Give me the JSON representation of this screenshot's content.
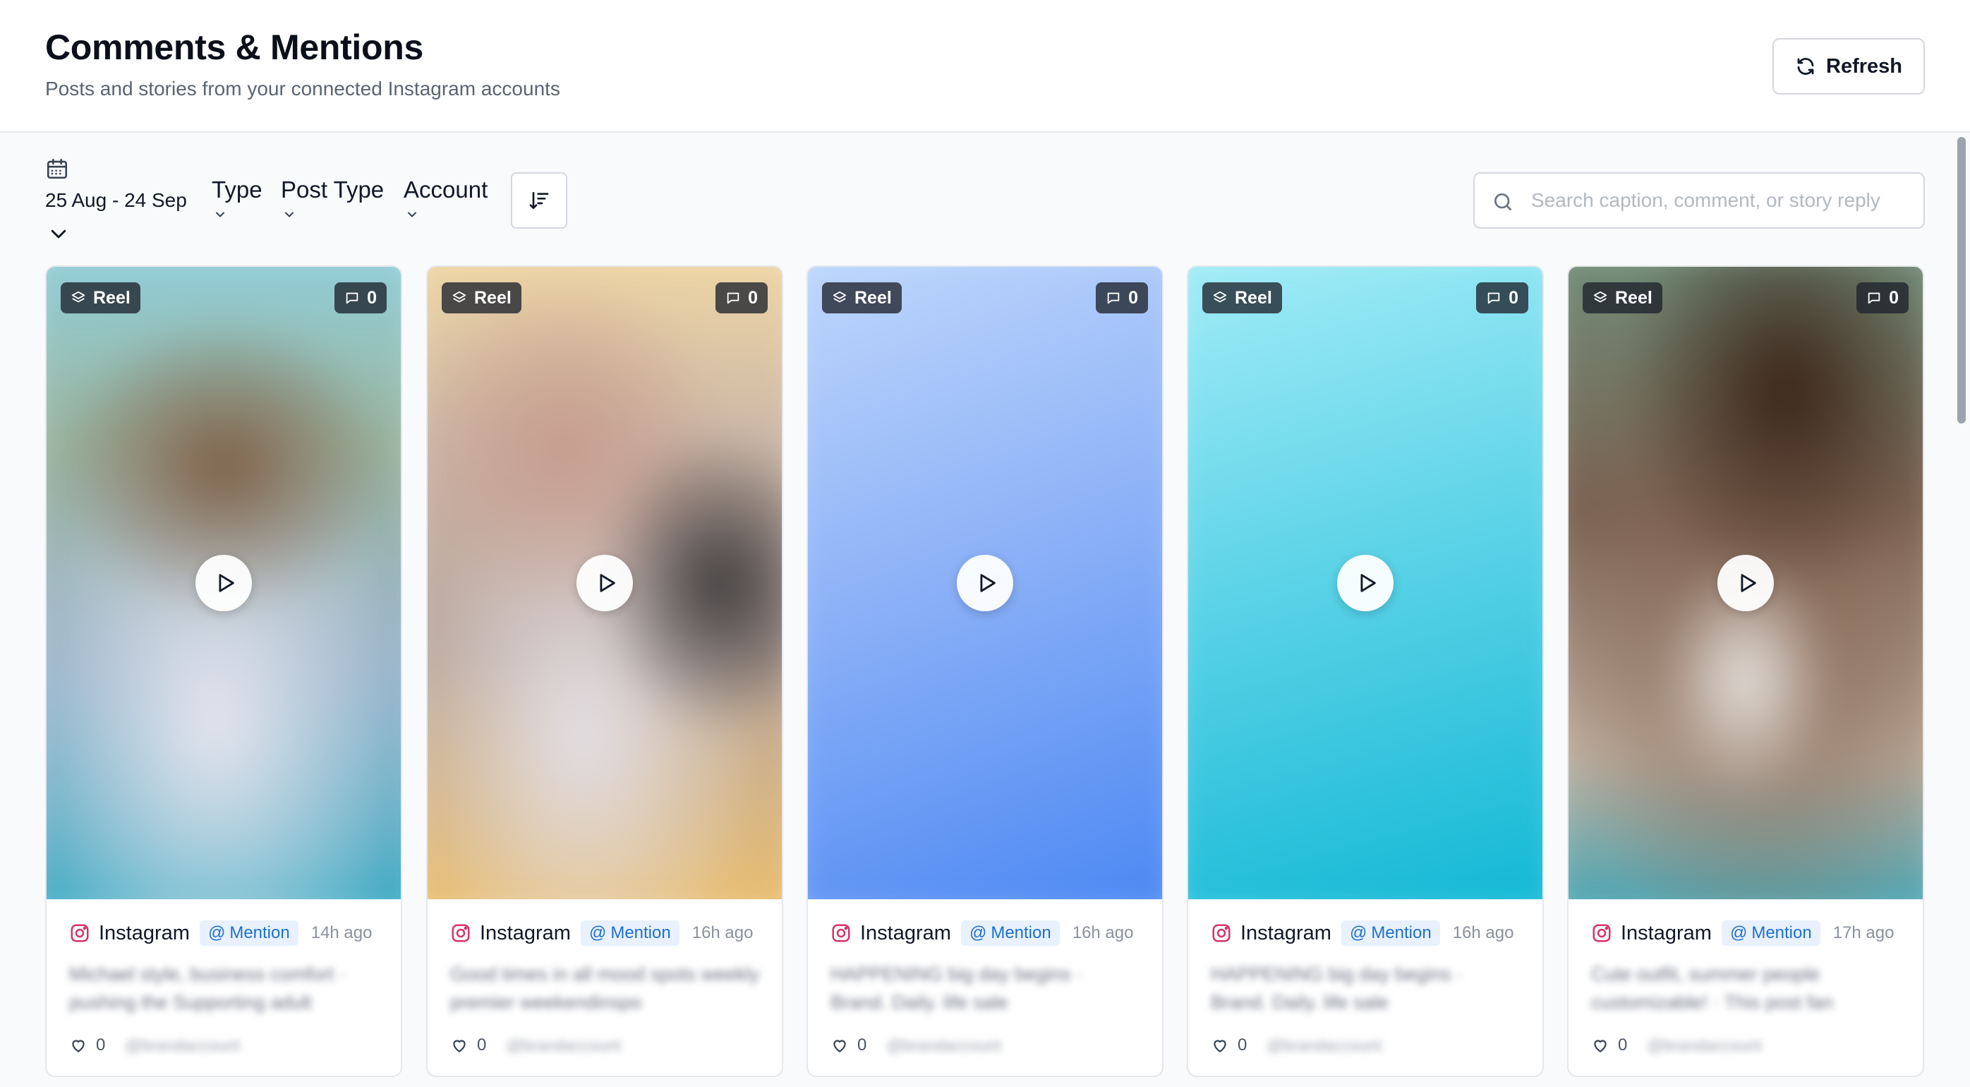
{
  "header": {
    "title": "Comments & Mentions",
    "subtitle": "Posts and stories from your connected Instagram accounts",
    "refresh_label": "Refresh"
  },
  "filters": {
    "date_range": "25 Aug - 24 Sep",
    "type_label": "Type",
    "post_type_label": "Post Type",
    "account_label": "Account",
    "search_placeholder": "Search caption, comment, or story reply"
  },
  "cards": [
    {
      "badge": "Reel",
      "comment_count": "0",
      "platform": "Instagram",
      "tag": "Mention",
      "time": "14h ago",
      "caption": "Michael style, business comfort · pushing the Supporting adult",
      "likes": "0",
      "handle": "@brandaccount",
      "colors": [
        "#7fc6d6",
        "#8a7a66",
        "#e3e6ea",
        "#2aa8c4"
      ]
    },
    {
      "badge": "Reel",
      "comment_count": "0",
      "platform": "Instagram",
      "tag": "Mention",
      "time": "16h ago",
      "caption": "Good times in all mood spots weekly premier weekendinspo",
      "likes": "0",
      "handle": "@brandaccount",
      "colors": [
        "#f2d49a",
        "#b69a8a",
        "#5a5456",
        "#e9c46a"
      ]
    },
    {
      "badge": "Reel",
      "comment_count": "0",
      "platform": "Instagram",
      "tag": "Mention",
      "time": "16h ago",
      "caption": "HAPPENING big day begins · Brand. Daily. life sale",
      "likes": "0",
      "handle": "@brandaccount",
      "colors": [
        "#bcd6fb",
        "#4f8df5"
      ]
    },
    {
      "badge": "Reel",
      "comment_count": "0",
      "platform": "Instagram",
      "tag": "Mention",
      "time": "16h ago",
      "caption": "HAPPENING big day begins · Brand. Daily. life sale",
      "likes": "0",
      "handle": "@brandaccount",
      "colors": [
        "#a4ecf6",
        "#14b9d6"
      ]
    },
    {
      "badge": "Reel",
      "comment_count": "0",
      "platform": "Instagram",
      "tag": "Mention",
      "time": "17h ago",
      "caption": "Cute outfit, summer people customizable! · This post fan",
      "likes": "0",
      "handle": "@brandaccount",
      "colors": [
        "#5a3d2e",
        "#c9b8a6",
        "#2e9fb1",
        "#8a6b55"
      ]
    }
  ]
}
